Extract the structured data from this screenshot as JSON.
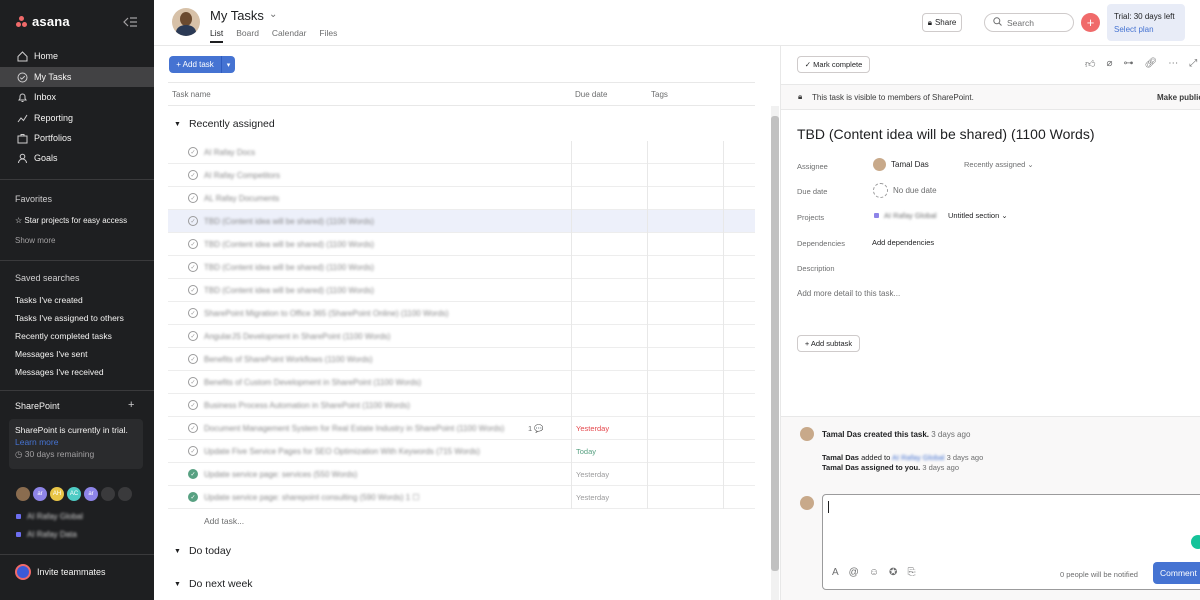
{
  "sidebar": {
    "logo": "asana",
    "nav": [
      {
        "label": "Home",
        "icon": "home-icon"
      },
      {
        "label": "My Tasks",
        "icon": "check-circle-icon"
      },
      {
        "label": "Inbox",
        "icon": "bell-icon"
      },
      {
        "label": "Reporting",
        "icon": "chart-line-icon"
      },
      {
        "label": "Portfolios",
        "icon": "portfolio-icon"
      },
      {
        "label": "Goals",
        "icon": "person-icon"
      }
    ],
    "favorites_title": "Favorites",
    "favorites_hint": "☆ Star projects for easy access",
    "show_more": "Show more",
    "saved_title": "Saved searches",
    "saved": [
      "Tasks I've created",
      "Tasks I've assigned to others",
      "Recently completed tasks",
      "Messages I've sent",
      "Messages I've received"
    ],
    "team_title": "SharePoint",
    "team_add": "+",
    "trial_text": "SharePoint is currently in trial.",
    "learn_more": "Learn more",
    "remaining": "30 days remaining",
    "avatars": [
      {
        "text": "",
        "color": "#8a6c4f"
      },
      {
        "text": "ar",
        "color": "#8d84e8"
      },
      {
        "text": "AH",
        "color": "#e8c547"
      },
      {
        "text": "AC",
        "color": "#4ecbc4"
      },
      {
        "text": "ar",
        "color": "#8d84e8"
      },
      {
        "text": "",
        "color": "#3a3a3c"
      },
      {
        "text": "",
        "color": "#3a3a3c"
      }
    ],
    "projects": [
      "AI Rafay Global",
      "AI Rafay Data"
    ],
    "invite": "Invite teammates"
  },
  "header": {
    "title": "My Tasks",
    "tabs": [
      "List",
      "Board",
      "Calendar",
      "Files"
    ],
    "share": "Share",
    "search_placeholder": "Search",
    "trial_line1": "Trial: 30 days left",
    "trial_line2": "Select plan"
  },
  "list": {
    "add_task": "+ Add task",
    "columns": [
      "Task name",
      "Due date",
      "Tags"
    ],
    "sections": [
      "Recently assigned",
      "Do today",
      "Do next week"
    ],
    "tasks": [
      {
        "name": "AI Rafay Docs",
        "due": "",
        "due_color": "#8a8a8b",
        "done": false,
        "comments": ""
      },
      {
        "name": "AI Rafay Competitors",
        "due": "",
        "due_color": "#8a8a8b",
        "done": false,
        "comments": ""
      },
      {
        "name": "AL Rafay Documents",
        "due": "",
        "due_color": "#8a8a8b",
        "done": false,
        "comments": ""
      },
      {
        "name": "TBD (Content idea will be shared) (1100 Words)",
        "due": "",
        "due_color": "#8a8a8b",
        "done": false,
        "comments": ""
      },
      {
        "name": "TBD (Content idea will be shared) (1100 Words)",
        "due": "",
        "due_color": "#8a8a8b",
        "done": false,
        "comments": ""
      },
      {
        "name": "TBD (Content idea will be shared) (1100 Words)",
        "due": "",
        "due_color": "#8a8a8b",
        "done": false,
        "comments": ""
      },
      {
        "name": "TBD (Content idea will be shared) (1100 Words)",
        "due": "",
        "due_color": "#8a8a8b",
        "done": false,
        "comments": ""
      },
      {
        "name": "SharePoint Migration to Office 365 (SharePoint Online) (1100 Words)",
        "due": "",
        "due_color": "#8a8a8b",
        "done": false,
        "comments": ""
      },
      {
        "name": "AngularJS Development in SharePoint (1100 Words)",
        "due": "",
        "due_color": "#8a8a8b",
        "done": false,
        "comments": ""
      },
      {
        "name": "Benefits of SharePoint Workflows (1100 Words)",
        "due": "",
        "due_color": "#8a8a8b",
        "done": false,
        "comments": ""
      },
      {
        "name": "Benefits of Custom Development in SharePoint (1100 Words)",
        "due": "",
        "due_color": "#8a8a8b",
        "done": false,
        "comments": ""
      },
      {
        "name": "Business Process Automation in SharePoint (1100 Words)",
        "due": "",
        "due_color": "#8a8a8b",
        "done": false,
        "comments": ""
      },
      {
        "name": "Document Management System for Real Estate Industry in SharePoint (1100 Words)",
        "due": "Yesterday",
        "due_color": "#e5484d",
        "done": false,
        "comments": "1 💬"
      },
      {
        "name": "Update Five Service Pages for SEO Optimization With Keywords (715 Words)",
        "due": "Today",
        "due_color": "#58a182",
        "done": false,
        "comments": ""
      },
      {
        "name": "Update service page: services (550 Words)",
        "due": "Yesterday",
        "due_color": "#9b9b9c",
        "done": true,
        "comments": ""
      },
      {
        "name": "Update service page: sharepoint consulting (590 Words) 1 ☐",
        "due": "Yesterday",
        "due_color": "#9b9b9c",
        "done": true,
        "comments": ""
      }
    ],
    "add_link": "Add task..."
  },
  "detail": {
    "mark_complete": "✓ Mark complete",
    "visibility": "This task is visible to members of SharePoint.",
    "make_public": "Make public",
    "title": "TBD (Content idea will be shared) (1100 Words)",
    "fields": {
      "assignee_label": "Assignee",
      "assignee": "Tamal Das",
      "assignee_section": "Recently assigned ⌄",
      "due_label": "Due date",
      "due": "No due date",
      "projects_label": "Projects",
      "project": "AI Rafay Global",
      "project_section": "Untitled section ⌄",
      "dependencies_label": "Dependencies",
      "dependencies": "Add dependencies",
      "description_label": "Description",
      "description_placeholder": "Add more detail to this task..."
    },
    "add_subtask": "+ Add subtask",
    "activity": {
      "created_by": "Tamal Das created this task.",
      "created_time": "3 days ago",
      "added_by": "Tamal Das",
      "added_text": "added to",
      "added_project": "AI Rafay Global",
      "added_time": "3 days ago",
      "assigned_text": "Tamal Das assigned to you.",
      "assigned_time": "3 days ago"
    },
    "comment_notify": "0 people will be notified",
    "comment_button": "Comment"
  }
}
